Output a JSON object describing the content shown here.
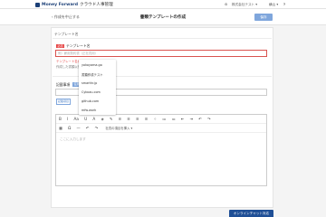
{
  "header": {
    "logo_text": "Money Forward",
    "product_text": "クラウド人事管理",
    "gear_glyph": "⚙",
    "company": "株式会社テスト ▾",
    "user": "横山 ▾",
    "help": "?"
  },
  "subheader": {
    "back_label": "‹ 作成を中止する",
    "title": "書類テンプレートの作成",
    "save_label": "保存"
  },
  "form": {
    "section_title": "テンプレート名",
    "required_badge": "必須",
    "name_label": "テンプレート名",
    "name_placeholder": "例）雇用契約書（正社員用）",
    "error_text": "テンプレート名が",
    "hint_text": "作成した書類以外",
    "condition_label": "記載事項",
    "condition_badge": "任意",
    "condition_button": "記載項目"
  },
  "editor": {
    "toolbar_row1": [
      "B",
      "I",
      "Aa",
      "U",
      "A",
      "◈",
      "✎",
      "≡",
      "≡",
      "≡",
      "≡",
      "⁘",
      "≔",
      "≔",
      "⇤",
      "⇥",
      "↶",
      "↷"
    ],
    "toolbar_row2": [
      "▦",
      "Ω",
      "—",
      "↶",
      "↷"
    ],
    "insert_label": "社員の項目を挿入 ▾",
    "placeholder": "ここに入力します"
  },
  "dropdown": {
    "items": [
      "yokoyama.go",
      "書類作成テスト",
      "smarthr.jp",
      "Cybozu.com",
      "github.com",
      "mfw.work"
    ]
  },
  "chat": {
    "label": "オンラインチャット対応"
  }
}
